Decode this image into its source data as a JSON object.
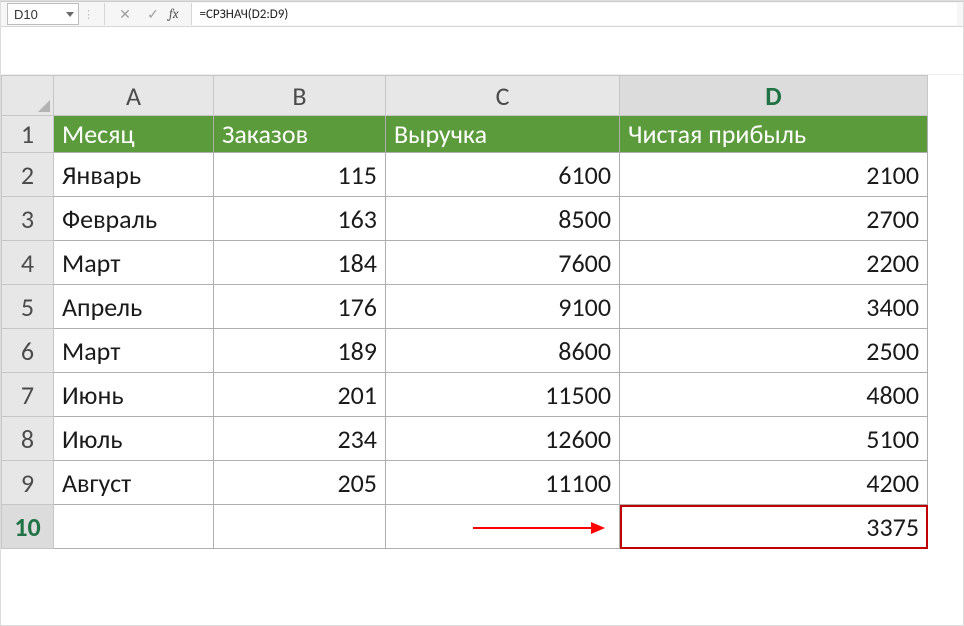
{
  "formula_bar": {
    "cell_ref": "D10",
    "cancel_glyph": "✕",
    "accept_glyph": "✓",
    "fx_label": "fx",
    "formula": "=СРЗНАЧ(D2:D9)"
  },
  "columns": {
    "A": "A",
    "B": "B",
    "C": "C",
    "D": "D"
  },
  "active_column": "D",
  "active_row": "10",
  "row_labels": [
    "1",
    "2",
    "3",
    "4",
    "5",
    "6",
    "7",
    "8",
    "9",
    "10"
  ],
  "headers": {
    "A": "Месяц",
    "B": "Заказов",
    "C": "Выручка",
    "D": "Чистая прибыль"
  },
  "rows": [
    {
      "A": "Январь",
      "B": "115",
      "C": "6100",
      "D": "2100"
    },
    {
      "A": "Февраль",
      "B": "163",
      "C": "8500",
      "D": "2700"
    },
    {
      "A": "Март",
      "B": "184",
      "C": "7600",
      "D": "2200"
    },
    {
      "A": "Апрель",
      "B": "176",
      "C": "9100",
      "D": "3400"
    },
    {
      "A": "Март",
      "B": "189",
      "C": "8600",
      "D": "2500"
    },
    {
      "A": "Июнь",
      "B": "201",
      "C": "11500",
      "D": "4800"
    },
    {
      "A": "Июль",
      "B": "234",
      "C": "12600",
      "D": "5100"
    },
    {
      "A": "Август",
      "B": "205",
      "C": "11100",
      "D": "4200"
    }
  ],
  "result_row": {
    "A": "",
    "B": "",
    "C": "",
    "D": "3375"
  },
  "chart_data": {
    "type": "table",
    "title": "",
    "columns": [
      "Месяц",
      "Заказов",
      "Выручка",
      "Чистая прибыль"
    ],
    "data": [
      [
        "Январь",
        115,
        6100,
        2100
      ],
      [
        "Февраль",
        163,
        8500,
        2700
      ],
      [
        "Март",
        184,
        7600,
        2200
      ],
      [
        "Апрель",
        176,
        9100,
        3400
      ],
      [
        "Март",
        189,
        8600,
        2500
      ],
      [
        "Июнь",
        201,
        11500,
        4800
      ],
      [
        "Июль",
        234,
        12600,
        5100
      ],
      [
        "Август",
        205,
        11100,
        4200
      ]
    ],
    "aggregate": {
      "column": "Чистая прибыль",
      "function": "AVERAGE",
      "value": 3375
    }
  }
}
